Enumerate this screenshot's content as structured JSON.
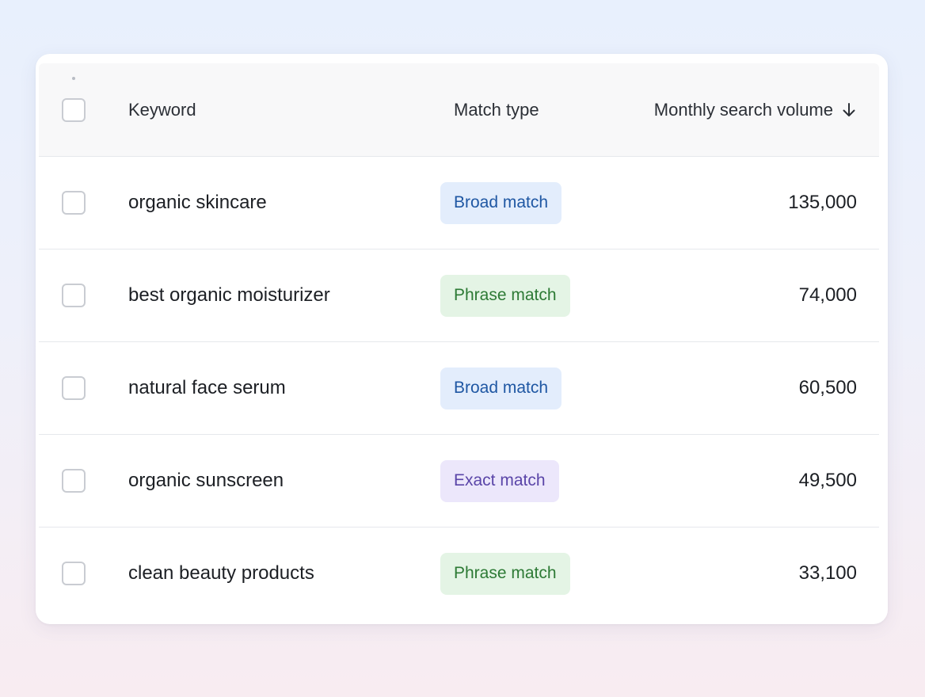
{
  "table": {
    "columns": {
      "keyword": "Keyword",
      "match_type": "Match type",
      "volume": "Monthly search volume"
    },
    "sort": {
      "column": "volume",
      "direction": "descending",
      "icon": "arrow-down-icon"
    },
    "rows": [
      {
        "keyword": "organic skincare",
        "match_type": "Broad match",
        "match_variant": "broad",
        "volume": "135,000"
      },
      {
        "keyword": "best organic moisturizer",
        "match_type": "Phrase match",
        "match_variant": "phrase",
        "volume": "74,000"
      },
      {
        "keyword": "natural face serum",
        "match_type": "Broad match",
        "match_variant": "broad",
        "volume": "60,500"
      },
      {
        "keyword": "organic sunscreen",
        "match_type": "Exact match",
        "match_variant": "exact",
        "volume": "49,500"
      },
      {
        "keyword": "clean beauty products",
        "match_type": "Phrase match",
        "match_variant": "phrase",
        "volume": "33,100"
      }
    ]
  },
  "colors": {
    "broad_bg": "#e3edfc",
    "broad_text": "#1f57a3",
    "phrase_bg": "#e4f4e5",
    "phrase_text": "#2d7a35",
    "exact_bg": "#ece7fb",
    "exact_text": "#5a45a8"
  }
}
